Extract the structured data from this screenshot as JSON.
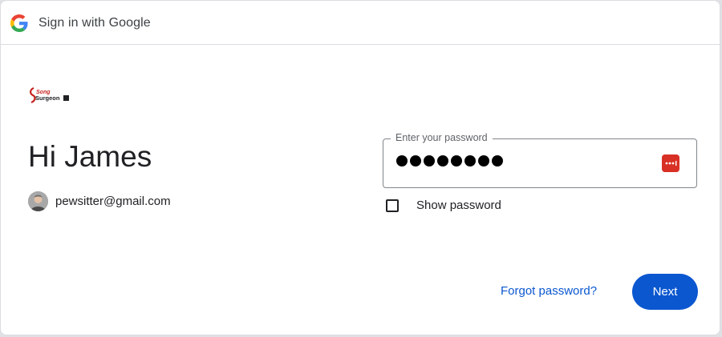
{
  "header": {
    "icon": "google-g-icon",
    "title": "Sign in with Google"
  },
  "logo": {
    "text": "Song Surgeon",
    "icon": "song-surgeon-logo"
  },
  "main": {
    "greeting": "Hi James",
    "account_email": "pewsitter@gmail.com",
    "avatar_icon": "user-avatar"
  },
  "password": {
    "label": "Enter your password",
    "masked_value": "●●●●●●●●",
    "manager_icon": "password-manager-key-icon"
  },
  "show_password": {
    "label": "Show password",
    "checked": false
  },
  "actions": {
    "forgot_label": "Forgot password?",
    "next_label": "Next"
  },
  "colors": {
    "primary": "#0b57d0",
    "key_icon": "#d93025",
    "border": "#dadce0"
  }
}
